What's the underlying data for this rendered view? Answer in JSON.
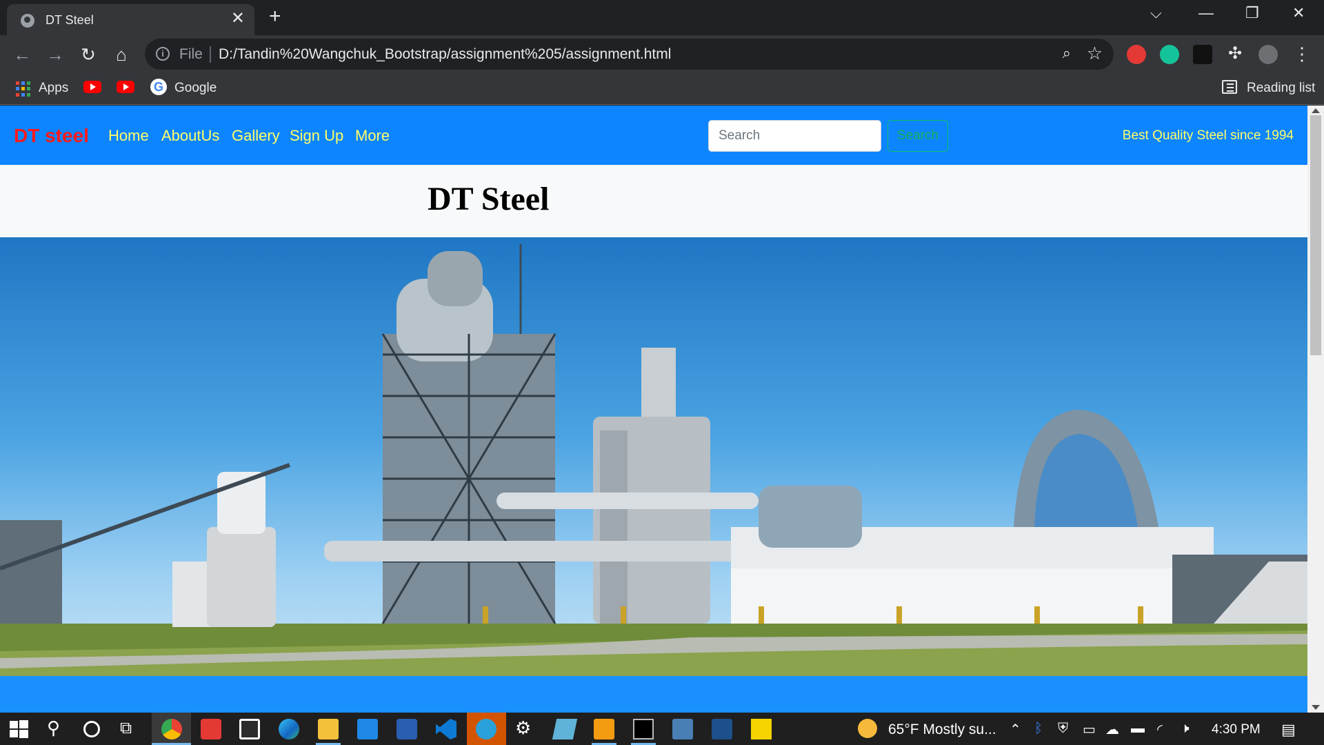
{
  "browser": {
    "tab_title": "DT Steel",
    "url_scheme_label": "File",
    "url": "D:/Tandin%20Wangchuk_Bootstrap/assignment%205/assignment.html",
    "bookmarks": {
      "apps": "Apps",
      "google": "Google",
      "reading_list": "Reading list"
    }
  },
  "navbar": {
    "brand": "DT steel",
    "links": [
      "Home",
      "AboutUs",
      "Gallery",
      "Sign Up",
      "More"
    ],
    "search_placeholder": "Search",
    "search_button": "Search",
    "tagline": "Best Quality Steel since 1994"
  },
  "page": {
    "heading": "DT Steel"
  },
  "taskbar": {
    "weather": "65°F  Mostly su...",
    "time": "4:30 PM"
  },
  "colors": {
    "navbar_bg": "#0d85ff",
    "brand": "#ff1a1a",
    "nav_link": "#ffff66",
    "search_button_outline": "#12b35a"
  }
}
